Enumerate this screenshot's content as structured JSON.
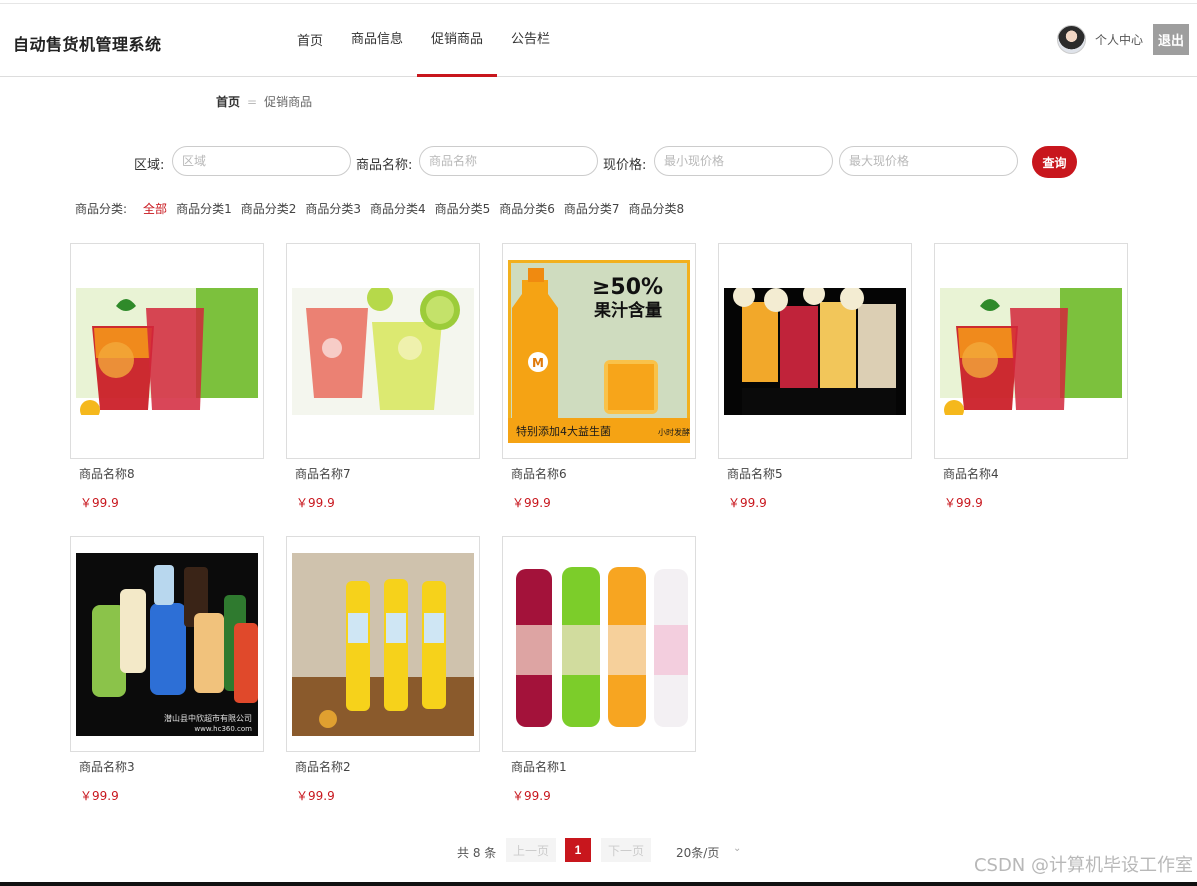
{
  "header": {
    "brand": "自动售货机管理系统",
    "nav": [
      {
        "label": "首页"
      },
      {
        "label": "商品信息"
      },
      {
        "label": "促销商品",
        "active": true
      },
      {
        "label": "公告栏"
      }
    ],
    "user_center": "个人中心",
    "logout": "退出"
  },
  "breadcrumb": {
    "home": "首页",
    "separator": "=",
    "current": "促销商品"
  },
  "search": {
    "region_label": "区域:",
    "region_placeholder": "区域",
    "name_label": "商品名称:",
    "name_placeholder": "商品名称",
    "price_label": "现价格:",
    "min_placeholder": "最小现价格",
    "max_placeholder": "最大现价格",
    "query_button": "查询"
  },
  "categories": {
    "label": "商品分类:",
    "items": [
      "全部",
      "商品分类1",
      "商品分类2",
      "商品分类3",
      "商品分类4",
      "商品分类5",
      "商品分类6",
      "商品分类7",
      "商品分类8"
    ],
    "active": "全部"
  },
  "products": [
    {
      "name": "商品名称8",
      "price": "￥99.9",
      "image": "iced-fruit-tea"
    },
    {
      "name": "商品名称7",
      "price": "￥99.9",
      "image": "lemon-soda"
    },
    {
      "name": "商品名称6",
      "price": "￥99.9",
      "image": "juice-bottle-ad"
    },
    {
      "name": "商品名称5",
      "price": "￥99.9",
      "image": "smoothie-glasses"
    },
    {
      "name": "商品名称4",
      "price": "￥99.9",
      "image": "iced-fruit-tea"
    },
    {
      "name": "商品名称3",
      "price": "￥99.9",
      "image": "assorted-bottles"
    },
    {
      "name": "商品名称2",
      "price": "￥99.9",
      "image": "orange-soda-bottles"
    },
    {
      "name": "商品名称1",
      "price": "￥99.9",
      "image": "colorful-soda-bottles"
    }
  ],
  "promo_image_text": {
    "headline": "≥50%",
    "subline": "果汁含量",
    "banner": "特别添加4大益生菌",
    "badge": "小时发酵",
    "bottle_logo": "M"
  },
  "image_watermark": {
    "line1": "潜山县中欣超市有限公司",
    "line2": "www.hc360.com"
  },
  "pagination": {
    "total": "共 8 条",
    "prev": "上一页",
    "current_page": "1",
    "next": "下一页",
    "page_size": "20条/页"
  },
  "watermark": "CSDN @计算机毕设工作室",
  "colors": {
    "accent": "#c8161d",
    "border": "#dddddd"
  }
}
